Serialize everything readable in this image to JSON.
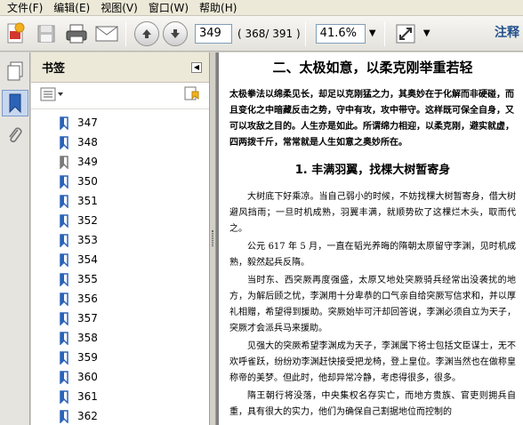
{
  "menu": [
    "文件(F)",
    "编辑(E)",
    "视图(V)",
    "窗口(W)",
    "帮助(H)"
  ],
  "toolbar": {
    "page_value": "349",
    "page_count": "( 368/ 391 )",
    "zoom": "41.6%",
    "comment_label": "注释"
  },
  "panel": {
    "title": "书签",
    "bookmarks": [
      "347",
      "348",
      "349",
      "350",
      "351",
      "352",
      "353",
      "354",
      "355",
      "356",
      "357",
      "358",
      "359",
      "360",
      "361",
      "362"
    ],
    "selected": "349"
  },
  "document": {
    "chapter_title": "二、太极如意，以柔克刚举重若轻",
    "intro": "太极拳法以绵柔见长，却足以克刚猛之力，其奥妙在于化解而非硬碰，而且变化之中暗藏反击之势，守中有攻，攻中带守。这样既可保全自身，又可以攻敌之目的。人生亦是如此。所谓绵力相迎，以柔克刚，避实就虚，四两拨千斤，常常就是人生如意之奥妙所在。",
    "section_title": "1. 丰满羽翼，找棵大树暂寄身",
    "paragraphs": [
      "大树底下好乘凉。当自己弱小的时候，不妨找棵大树暂寄身，借大树避风挡雨；一旦时机成熟，羽翼丰满，就顺势砍了这棵烂木头，取而代之。",
      "公元 617 年 5 月，一直在韬光养晦的隋朝太原留守李渊，见时机成熟，毅然起兵反隋。",
      "当时东、西突厥再度强盛，太原又地处突厥骑兵经常出没袭扰的地方，为解后顾之忧，李渊用十分卑恭的口气亲自给突厥写信求和，并以厚礼相赠，希望得到援助。突厥始毕可汗却回答说，李渊必须自立为天子，突厥才会派兵马来援助。",
      "见强大的突厥希望李渊成为天子，李渊属下将士包括文臣谋士，无不欢呼雀跃，纷纷劝李渊赶快接受把龙椅，登上皇位。李渊当然也在做称皇称帝的美梦。但此时，他却异常冷静，考虑得很多，很多。",
      "隋王朝行将没落，中央集权名存实亡，而地方贵族、官吏则拥兵自重，具有很大的实力，他们为确保自己割据地位而控制的"
    ]
  },
  "colors": {
    "bookmark_blue": "#2b63b8",
    "bookmark_gray": "#7a7a7a",
    "rail_active": "#c7d7ef"
  }
}
